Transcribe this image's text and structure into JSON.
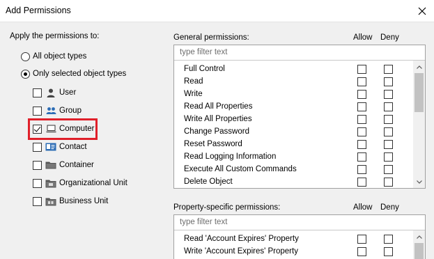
{
  "window": {
    "title": "Add Permissions"
  },
  "apply": {
    "label": "Apply the permissions to:",
    "options": [
      {
        "label": "All object types",
        "selected": false
      },
      {
        "label": "Only selected object types",
        "selected": true
      }
    ],
    "types": [
      {
        "label": "User",
        "checked": false,
        "icon": "user-icon"
      },
      {
        "label": "Group",
        "checked": false,
        "icon": "group-icon"
      },
      {
        "label": "Computer",
        "checked": true,
        "icon": "computer-icon"
      },
      {
        "label": "Contact",
        "checked": false,
        "icon": "contact-icon"
      },
      {
        "label": "Container",
        "checked": false,
        "icon": "folder-icon"
      },
      {
        "label": "Organizational Unit",
        "checked": false,
        "icon": "org-unit-icon"
      },
      {
        "label": "Business Unit",
        "checked": false,
        "icon": "business-unit-icon"
      }
    ],
    "highlight_color": "#e0202a"
  },
  "general": {
    "label": "General permissions:",
    "allow_label": "Allow",
    "deny_label": "Deny",
    "filter_placeholder": "type filter text",
    "items": [
      {
        "name": "Full Control",
        "allow": false,
        "deny": false
      },
      {
        "name": "Read",
        "allow": false,
        "deny": false
      },
      {
        "name": "Write",
        "allow": false,
        "deny": false
      },
      {
        "name": "Read All Properties",
        "allow": false,
        "deny": false
      },
      {
        "name": "Write All Properties",
        "allow": false,
        "deny": false
      },
      {
        "name": "Change Password",
        "allow": false,
        "deny": false
      },
      {
        "name": "Reset Password",
        "allow": false,
        "deny": false
      },
      {
        "name": "Read Logging Information",
        "allow": false,
        "deny": false
      },
      {
        "name": "Execute All Custom Commands",
        "allow": false,
        "deny": false
      },
      {
        "name": "Delete Object",
        "allow": false,
        "deny": false
      }
    ]
  },
  "property": {
    "label": "Property-specific permissions:",
    "allow_label": "Allow",
    "deny_label": "Deny",
    "filter_placeholder": "type filter text",
    "items": [
      {
        "name": "Read 'Account Expires' Property",
        "allow": false,
        "deny": false
      },
      {
        "name": "Write 'Account Expires' Property",
        "allow": false,
        "deny": false
      }
    ]
  }
}
